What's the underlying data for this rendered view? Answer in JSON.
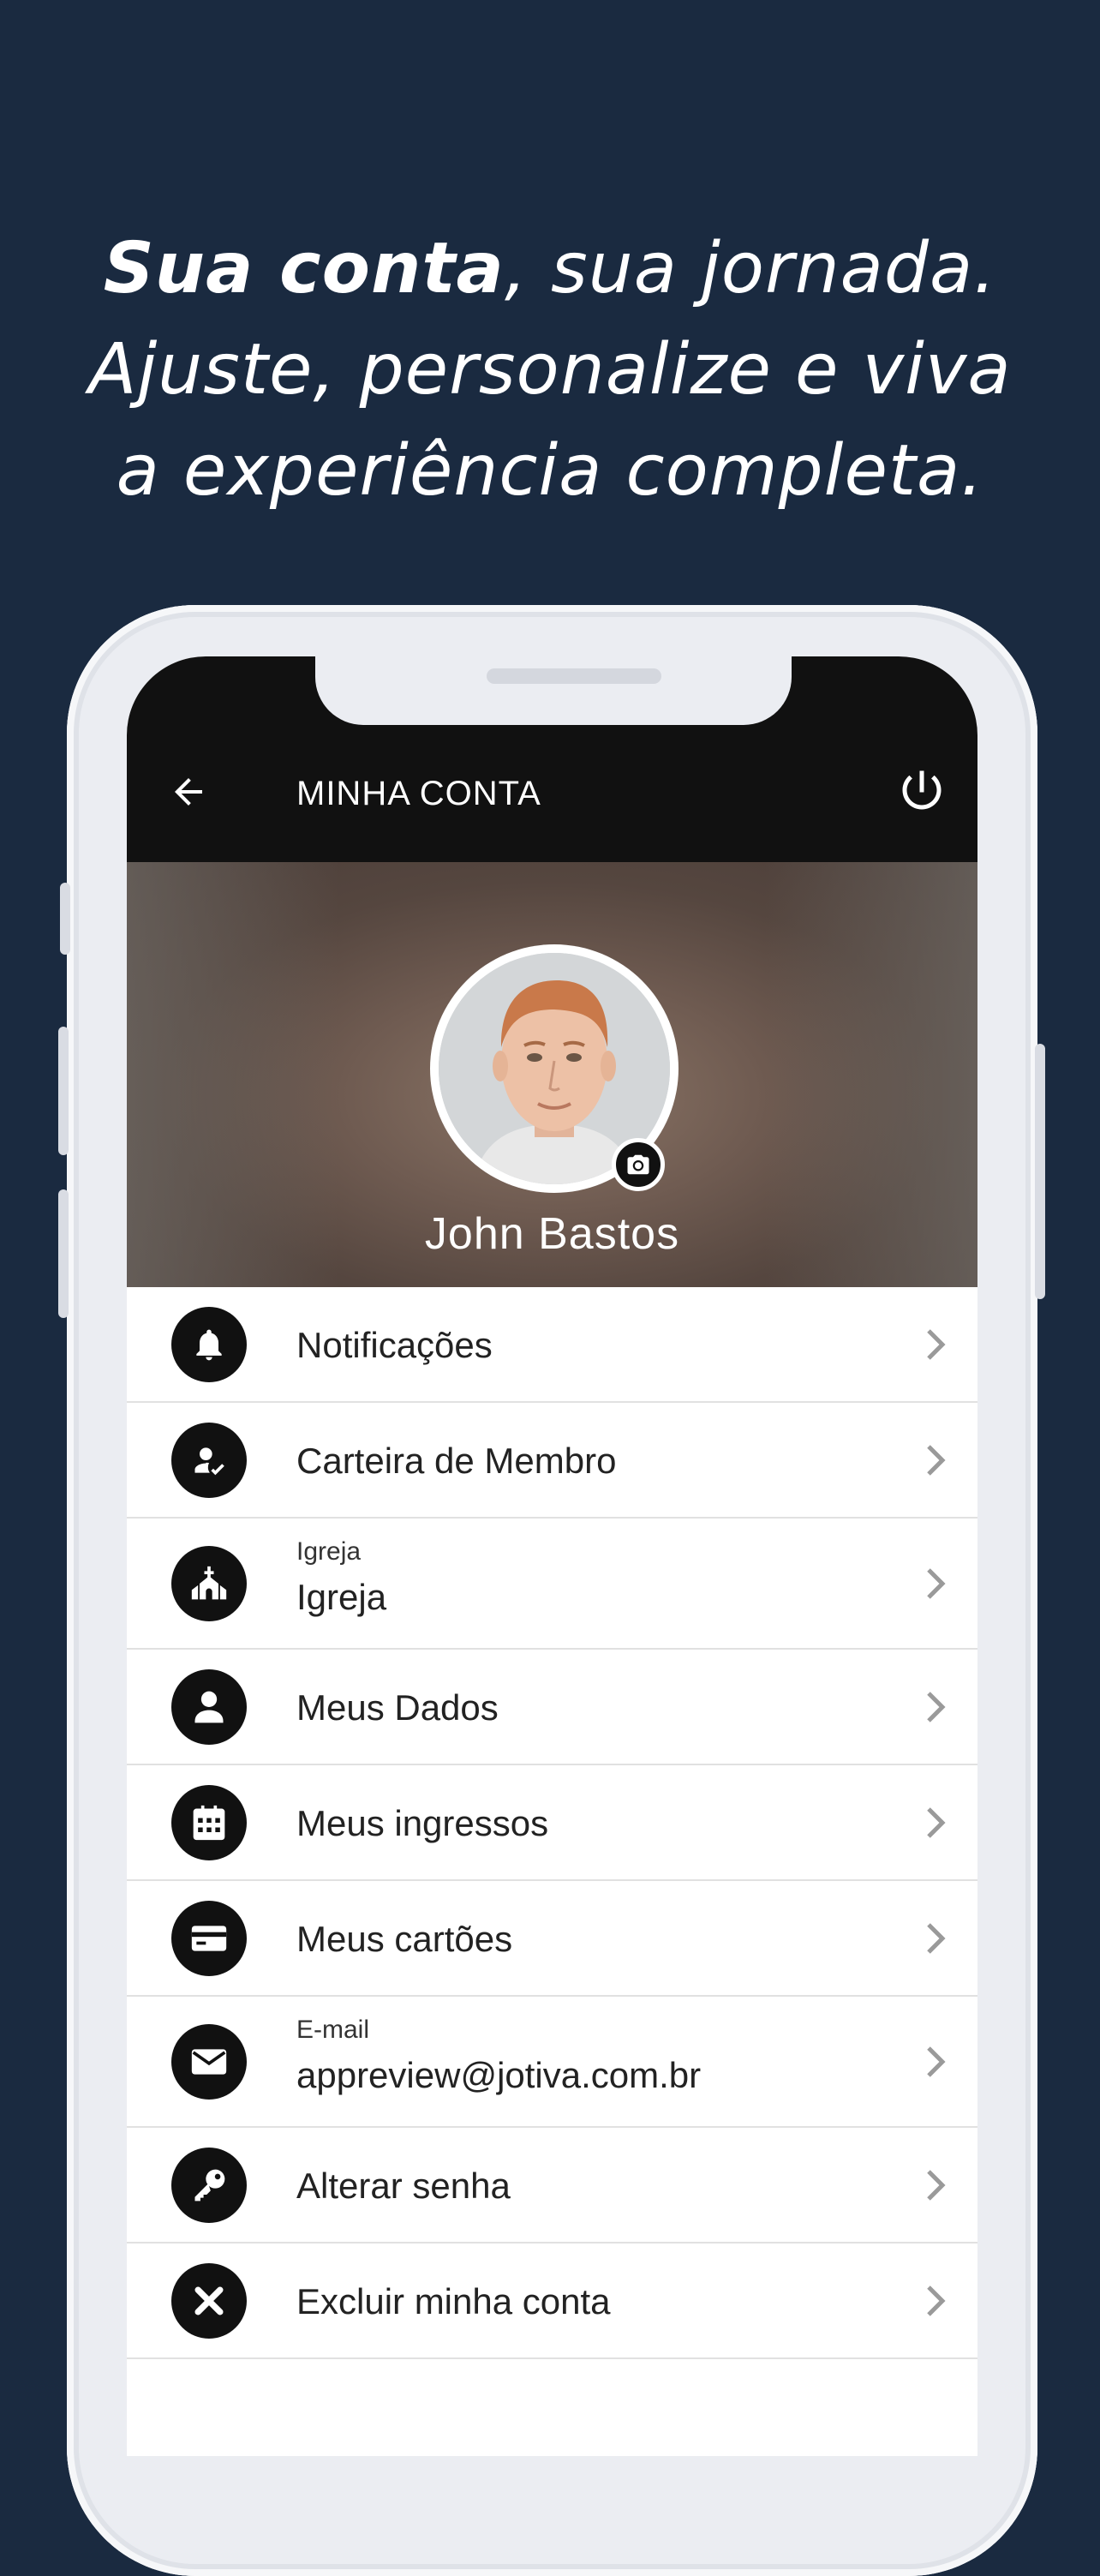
{
  "headline": {
    "bold": "Sua conta",
    "rest1": ", sua jornada.",
    "line2": "Ajuste, personalize e viva",
    "line3": "a experiência completa."
  },
  "appbar": {
    "title": "MINHA CONTA",
    "back_icon": "arrow-left-icon",
    "power_icon": "power-icon"
  },
  "profile": {
    "name": "John Bastos",
    "camera_icon": "camera-icon"
  },
  "menu": {
    "items": [
      {
        "label": "Notificações",
        "icon": "bell-icon"
      },
      {
        "label": "Carteira de Membro",
        "icon": "member-card-icon"
      },
      {
        "sublabel": "Igreja",
        "label": "Igreja",
        "icon": "church-icon"
      },
      {
        "label": "Meus Dados",
        "icon": "user-icon"
      },
      {
        "label": "Meus ingressos",
        "icon": "calendar-icon"
      },
      {
        "label": "Meus cartões",
        "icon": "credit-card-icon"
      },
      {
        "sublabel": "E-mail",
        "label": "appreview@jotiva.com.br",
        "icon": "mail-icon"
      },
      {
        "label": "Alterar senha",
        "icon": "key-icon"
      },
      {
        "label": "Excluir minha conta",
        "icon": "close-icon"
      }
    ]
  },
  "colors": {
    "background": "#1a2a40",
    "appbar": "#111111",
    "icon_circle": "#111111",
    "divider": "#e1e1e1"
  }
}
